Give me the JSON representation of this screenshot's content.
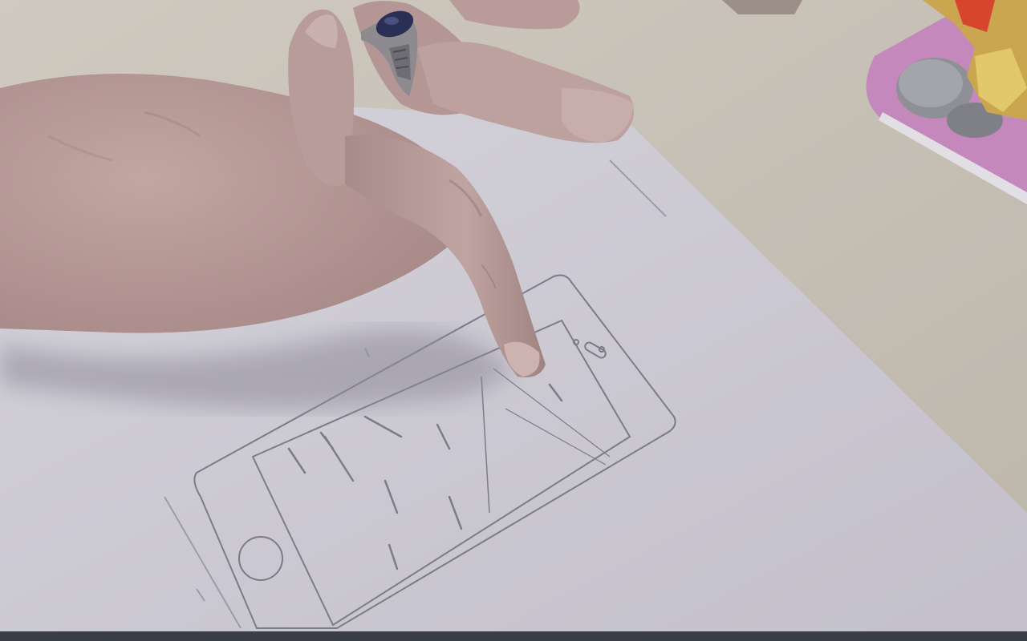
{
  "scene": {
    "description_tags": [
      "paper-prototype",
      "hand",
      "phone-wireframe-sketch",
      "coin-tray"
    ],
    "colors": {
      "table": "#c7c1b8",
      "paper": "#c9c7d0",
      "skin": "#b69a97",
      "skin_shadow": "#8f7674",
      "tray": "#c07fb8",
      "coin": "#8d8f94",
      "sketch_line": "#7c7b86",
      "ring_stone": "#2a2f55",
      "video_bar": "#3b3e47"
    }
  }
}
